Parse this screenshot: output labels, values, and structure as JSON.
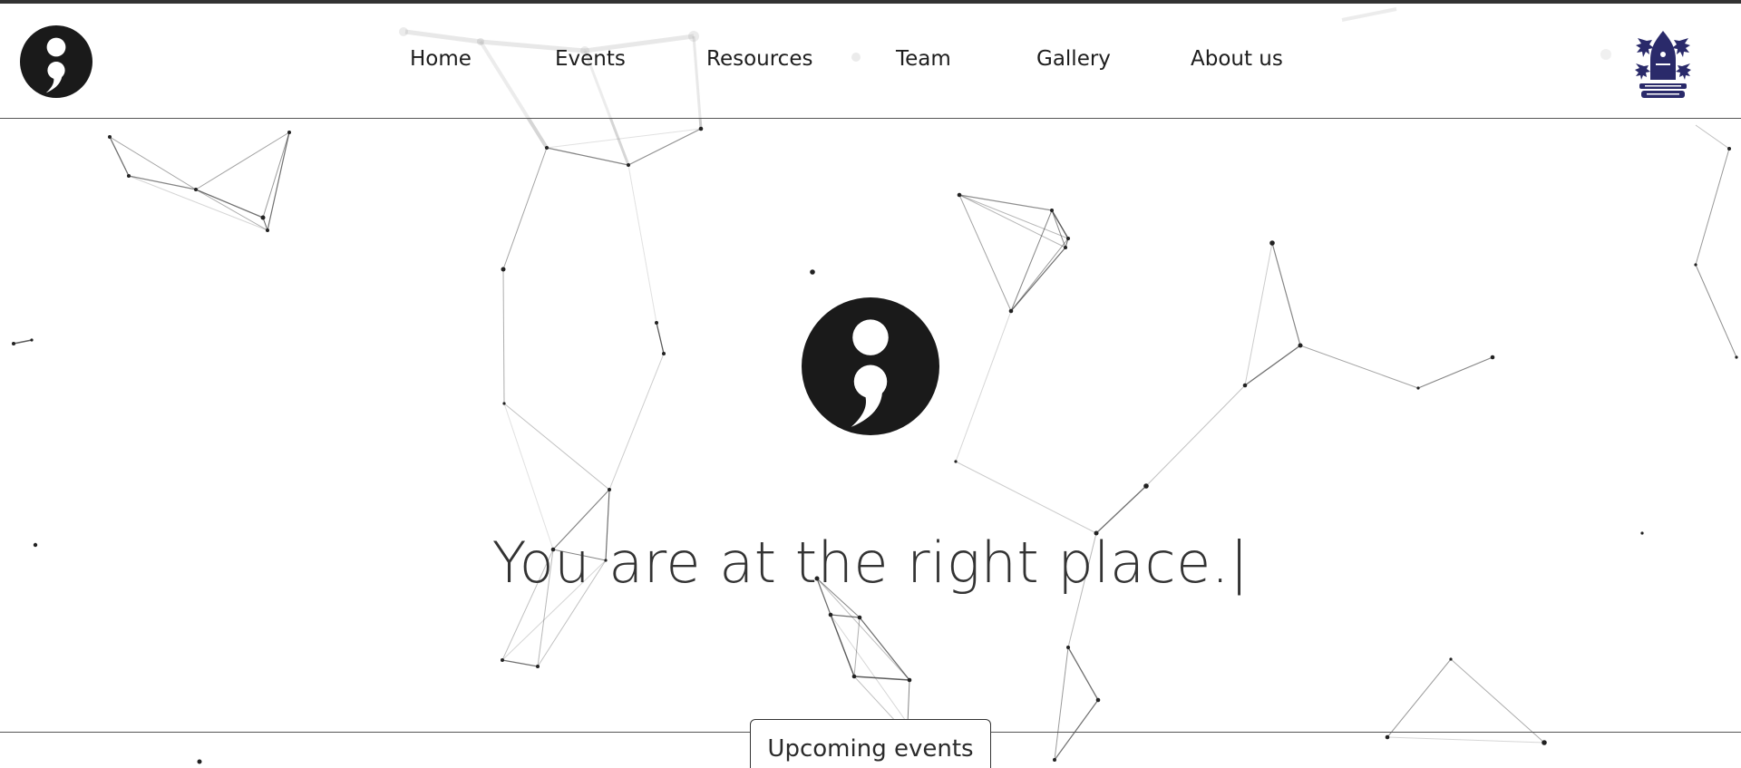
{
  "nav": {
    "logo_icon": "semicolon-logo-icon",
    "links": [
      {
        "label": "Home"
      },
      {
        "label": "Events"
      },
      {
        "label": "Resources"
      },
      {
        "label": "Team"
      },
      {
        "label": "Gallery"
      },
      {
        "label": "About us"
      }
    ],
    "crest_icon": "institution-crest-icon"
  },
  "hero": {
    "logo_icon": "semicolon-logo-icon",
    "tagline": "You are at the right place.",
    "caret": "|"
  },
  "cta": {
    "label": "Upcoming events"
  },
  "theme": {
    "ink": "#1a1a1a",
    "line": "#555555",
    "crest": "#2a2a6a"
  }
}
